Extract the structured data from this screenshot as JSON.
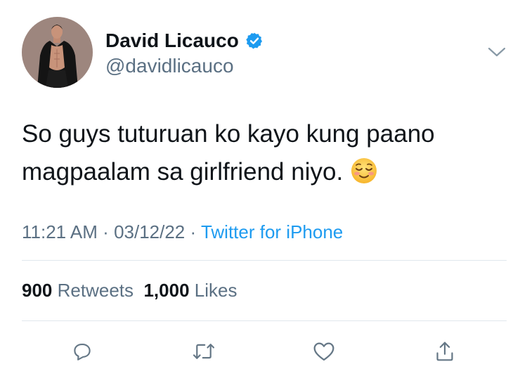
{
  "author": {
    "display_name": "David Licauco",
    "handle": "@davidlicauco",
    "verified": true,
    "avatar_icon": "profile-photo"
  },
  "tweet": {
    "text_line1": "So guys tuturuan ko kayo kung paano",
    "text_line2": "magpaalam sa girlfriend niyo.",
    "emoji": "smiling-face-icon",
    "time": "11:21 AM",
    "date": "03/12/22",
    "source": "Twitter for iPhone"
  },
  "stats": {
    "retweets_count": "900",
    "retweets_label": "Retweets",
    "likes_count": "1,000",
    "likes_label": "Likes"
  },
  "actions": [
    "reply-icon",
    "retweet-icon",
    "like-icon",
    "share-icon"
  ],
  "colors": {
    "accent": "#1d9bf0",
    "secondary_text": "#5b7083",
    "primary_text": "#0f1419",
    "divider": "#e1e8ed"
  }
}
